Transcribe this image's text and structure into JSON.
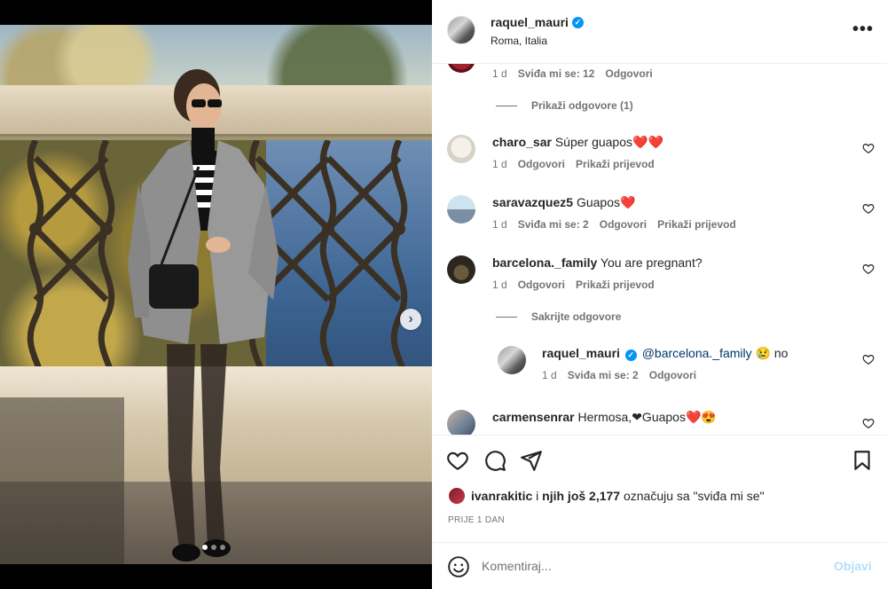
{
  "post": {
    "username": "raquel_mauri",
    "location": "Roma, Italia",
    "carousel": {
      "slide_count": 3,
      "active_slide": 1
    }
  },
  "comments": {
    "first": {
      "time": "1 d",
      "likes": "Sviđa mi se: 12",
      "reply": "Odgovori",
      "view_replies": "Prikaži odgovore (1)"
    },
    "items": [
      {
        "username": "charo_sar",
        "text": "Súper guapos❤️❤️",
        "time": "1 d",
        "reply": "Odgovori",
        "translate": "Prikaži prijevod"
      },
      {
        "username": "saravazquez5",
        "text": "Guapos❤️",
        "time": "1 d",
        "likes": "Sviđa mi se: 2",
        "reply": "Odgovori",
        "translate": "Prikaži prijevod"
      },
      {
        "username": "barcelona._family",
        "text": "You are pregnant?",
        "time": "1 d",
        "reply": "Odgovori",
        "translate": "Prikaži prijevod",
        "hide_replies": "Sakrijte odgovore"
      }
    ],
    "reply": {
      "username": "raquel_mauri",
      "mention": "@barcelona._family",
      "text": " 😢 no",
      "time": "1 d",
      "likes": "Sviđa mi se: 2",
      "reply": "Odgovori"
    },
    "last": {
      "username": "carmensenrar",
      "text": "Hermosa,❤Guapos❤️😍"
    }
  },
  "likes": {
    "user": "ivanrakitic",
    "joiner": " i ",
    "others": "njih još 2,177",
    "suffix": " označuju sa \"sviđa mi se\""
  },
  "time_ago": "PRIJE 1 DAN",
  "compose": {
    "placeholder": "Komentiraj...",
    "post_label": "Objavi"
  },
  "colors": {
    "accent": "#0095f6",
    "post_button_disabled": "#b2dffc",
    "meta_text": "#737373"
  },
  "icons": [
    "more-icon",
    "heart-icon",
    "comment-icon",
    "share-icon",
    "bookmark-icon",
    "emoji-icon",
    "chevron-right-icon",
    "verified-badge-icon"
  ]
}
